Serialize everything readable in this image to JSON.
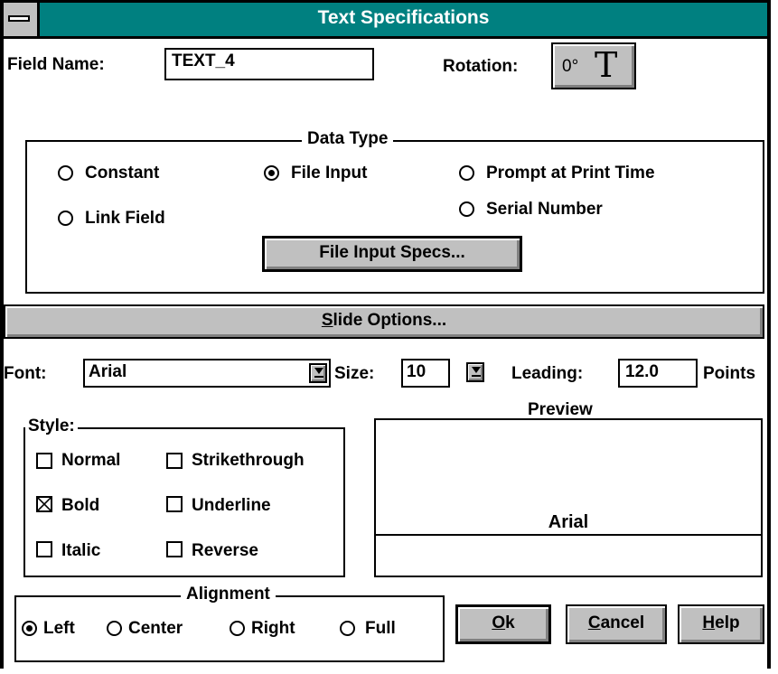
{
  "window": {
    "title": "Text Specifications"
  },
  "field_name": {
    "label": "Field Name:",
    "value": "TEXT_4"
  },
  "rotation": {
    "label": "Rotation:",
    "degree": "0°",
    "glyph": "T"
  },
  "data_type": {
    "title": "Data Type",
    "options": {
      "constant": "Constant",
      "file_input": "File Input",
      "prompt": "Prompt at Print Time",
      "link_field": "Link Field",
      "serial_number": "Serial Number"
    },
    "selected": "File Input",
    "specs_button": "File Input Specs..."
  },
  "slide_options": {
    "accel": "S",
    "rest": "lide Options..."
  },
  "font": {
    "label": "Font:",
    "value": "Arial"
  },
  "size": {
    "label": "Size:",
    "value": "10"
  },
  "leading": {
    "label": "Leading:",
    "value": "12.0",
    "unit": "Points"
  },
  "style": {
    "title": "Style:",
    "normal": "Normal",
    "strikethrough": "Strikethrough",
    "bold": "Bold",
    "underline": "Underline",
    "italic": "Italic",
    "reverse": "Reverse",
    "checked": [
      "Bold"
    ]
  },
  "preview": {
    "title": "Preview",
    "sample": "Arial"
  },
  "alignment": {
    "title": "Alignment",
    "left": "Left",
    "center": "Center",
    "right": "Right",
    "full": "Full",
    "selected": "Left"
  },
  "buttons": {
    "ok": {
      "accel": "O",
      "rest": "k"
    },
    "cancel": {
      "accel": "C",
      "rest": "ancel"
    },
    "help": {
      "accel": "H",
      "rest": "elp"
    }
  },
  "colors": {
    "titlebar": "#008080",
    "face": "#c0c0c0"
  }
}
